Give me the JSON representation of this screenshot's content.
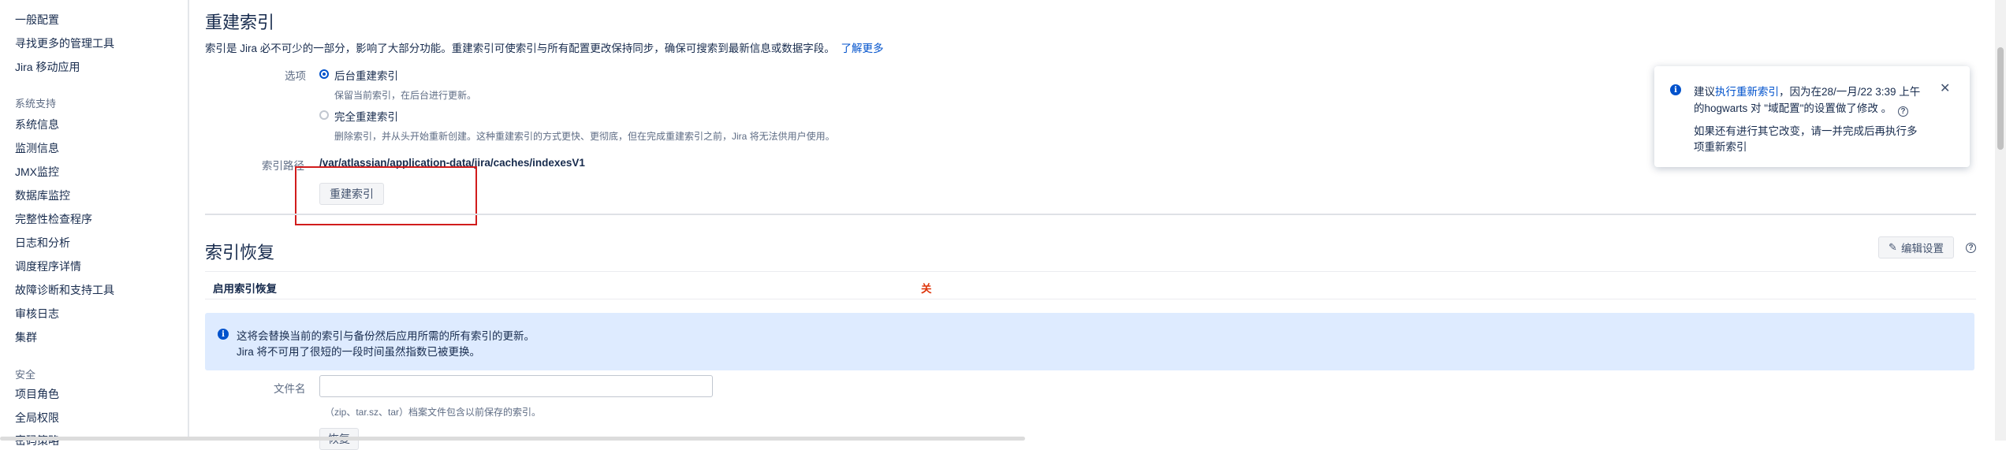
{
  "sidebar": {
    "items": [
      {
        "label": "一般配置",
        "header": false
      },
      {
        "label": "寻找更多的管理工具",
        "header": false
      },
      {
        "label": "Jira 移动应用",
        "header": false
      },
      {
        "label": "系统支持",
        "header": true
      },
      {
        "label": "系统信息",
        "header": false
      },
      {
        "label": "监测信息",
        "header": false
      },
      {
        "label": "JMX监控",
        "header": false
      },
      {
        "label": "数据库监控",
        "header": false
      },
      {
        "label": "完整性检查程序",
        "header": false
      },
      {
        "label": "日志和分析",
        "header": false
      },
      {
        "label": "调度程序详情",
        "header": false
      },
      {
        "label": "故障诊断和支持工具",
        "header": false
      },
      {
        "label": "审核日志",
        "header": false
      },
      {
        "label": "集群",
        "header": false
      },
      {
        "label": "安全",
        "header": true
      },
      {
        "label": "项目角色",
        "header": false
      },
      {
        "label": "全局权限",
        "header": false
      },
      {
        "label": "密码策略",
        "header": false
      }
    ]
  },
  "reindex": {
    "title": "重建索引",
    "description": "索引是 Jira 必不可少的一部分，影响了大部分功能。重建索引可使索引与所有配置更改保持同步，确保可搜索到最新信息或数据字段。",
    "learn_more": "了解更多",
    "option_label": "选项",
    "options": [
      {
        "label": "后台重建索引",
        "help": "保留当前索引，在后台进行更新。",
        "selected": true
      },
      {
        "label": "完全重建索引",
        "help": "删除索引，并从头开始重新创建。这种重建索引的方式更快、更彻底，但在完成重建索引之前，Jira 将无法供用户使用。",
        "selected": false
      }
    ],
    "path_label": "索引路径",
    "path_value": "/var/atlassian/application-data/jira/caches/indexesV1",
    "button": "重建索引"
  },
  "recovery": {
    "title": "索引恢复",
    "edit_button": "编辑设置",
    "enable_label": "启用索引恢复",
    "enable_value": "关",
    "info_line1": "这将会替换当前的索引与备份然后应用所需的所有索引的更新。",
    "info_line2": "Jira 将不可用了很短的一段时间虽然指数已被更换。",
    "file_label": "文件名",
    "file_value": "",
    "file_hint": "（zip、tar.sz、tar）档案文件包含以前保存的索引。",
    "restore_button": "恢复"
  },
  "flag": {
    "prefix": "建议",
    "link": "执行重新索引",
    "line1_rest": "，因为在28/一月/22 3:39 上午",
    "line2": "的hogwarts 对 \"域配置\"的设置做了修改 。",
    "line3": "如果还有进行其它改变，请一并完成后再执行多",
    "line4": "项重新索引"
  },
  "colors": {
    "link": "#0052cc",
    "highlight_box": "#d11c1c",
    "info_band": "#deebff",
    "off_value": "#de350b"
  }
}
